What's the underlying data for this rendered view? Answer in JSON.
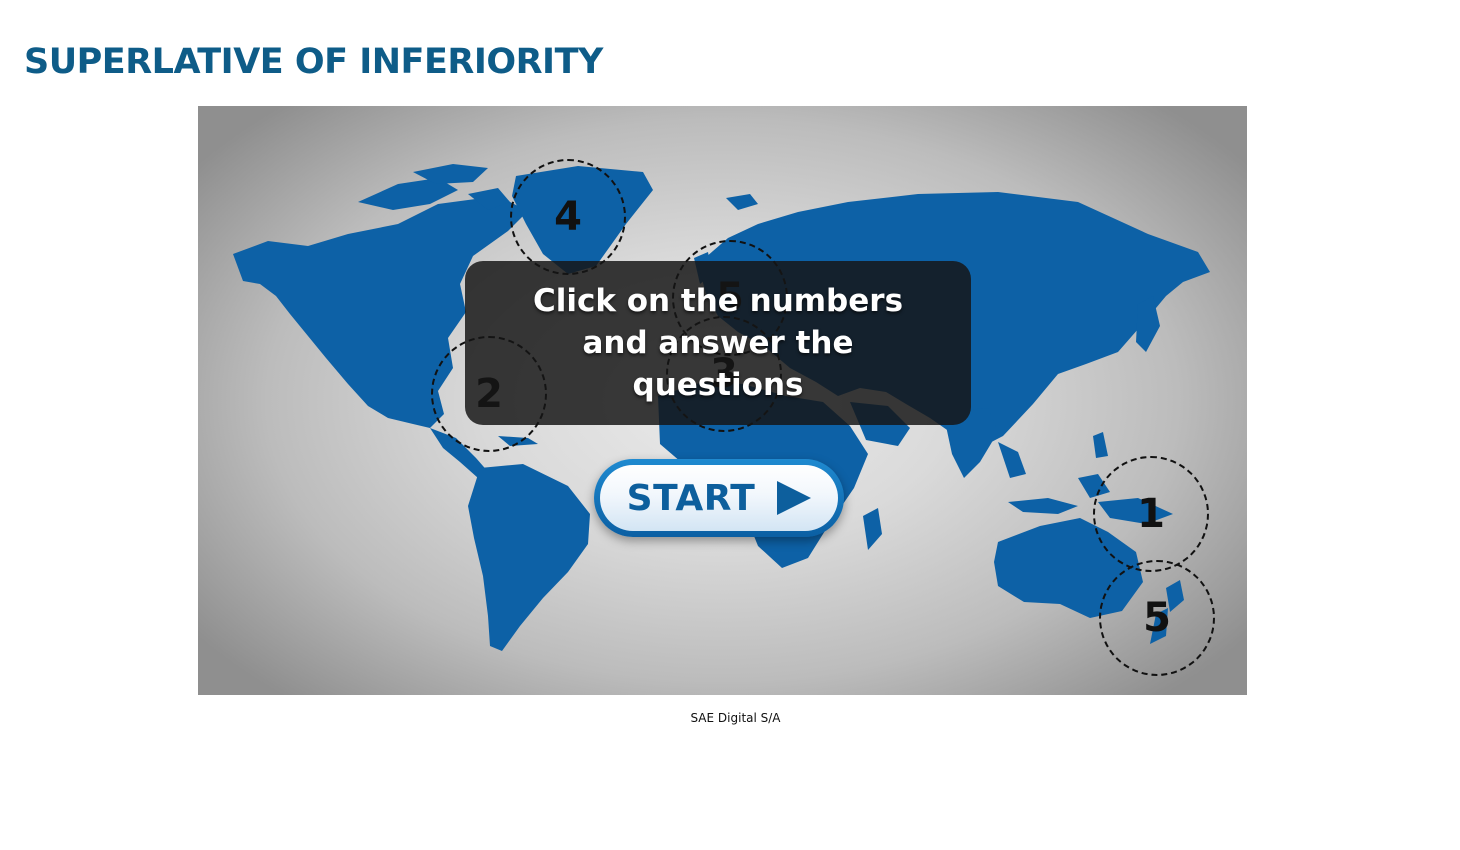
{
  "page": {
    "title": "SUPERLATIVE OF INFERIORITY",
    "credit": "SAE Digital S/A"
  },
  "activity": {
    "instruction": "Click on the numbers and answer the questions",
    "start_label": "START",
    "start_icon": "play-triangle-icon",
    "map_color": "#0d61a6",
    "markers": [
      {
        "number": "4",
        "region": "greenland"
      },
      {
        "number": "5",
        "region": "northern-europe"
      },
      {
        "number": "3",
        "region": "mediterranean"
      },
      {
        "number": "2",
        "region": "gulf-of-mexico"
      },
      {
        "number": "1",
        "region": "new-guinea"
      },
      {
        "number": "5",
        "region": "new-zealand"
      }
    ]
  },
  "colors": {
    "title": "#0e5c88",
    "button_blue": "#0d5f9d",
    "overlay": "#161616"
  }
}
